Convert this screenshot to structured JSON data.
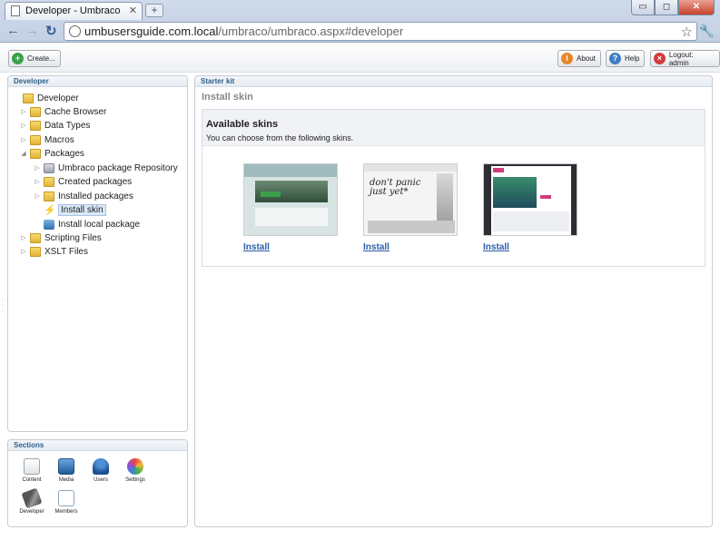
{
  "browser": {
    "tab_title": "Developer - Umbraco C...",
    "url_host": "umbusersguide.com.local",
    "url_path": "/umbraco/umbraco.aspx#developer"
  },
  "toolbar": {
    "create_label": "Create...",
    "about_label": "About",
    "help_label": "Help",
    "logout_label": "Logout: admin"
  },
  "tree_panel": {
    "title": "Developer",
    "items": [
      {
        "label": "Developer"
      },
      {
        "label": "Cache Browser"
      },
      {
        "label": "Data Types"
      },
      {
        "label": "Macros"
      },
      {
        "label": "Packages"
      },
      {
        "label": "Umbraco package Repository"
      },
      {
        "label": "Created packages"
      },
      {
        "label": "Installed packages"
      },
      {
        "label": "Install skin"
      },
      {
        "label": "Install local package"
      },
      {
        "label": "Scripting Files"
      },
      {
        "label": "XSLT Files"
      }
    ]
  },
  "sections_panel": {
    "title": "Sections",
    "items": [
      {
        "label": "Content",
        "icon": "content-icon"
      },
      {
        "label": "Media",
        "icon": "media-icon"
      },
      {
        "label": "Users",
        "icon": "users-icon"
      },
      {
        "label": "Settings",
        "icon": "settings-icon"
      },
      {
        "label": "Developer",
        "icon": "developer-icon"
      },
      {
        "label": "Members",
        "icon": "members-icon"
      }
    ]
  },
  "main": {
    "panel_title": "Starter kit",
    "page_title": "Install skin",
    "skins_heading": "Available skins",
    "skins_subtext": "You can choose from the following skins.",
    "skins": [
      {
        "install_label": "Install"
      },
      {
        "install_label": "Install",
        "thumb_text": "don't panic just yet*"
      },
      {
        "install_label": "Install"
      }
    ]
  },
  "colors": {
    "link": "#2a5da8",
    "panel_header_text": "#2b5f8a",
    "chrome": "#c3d0e4"
  }
}
